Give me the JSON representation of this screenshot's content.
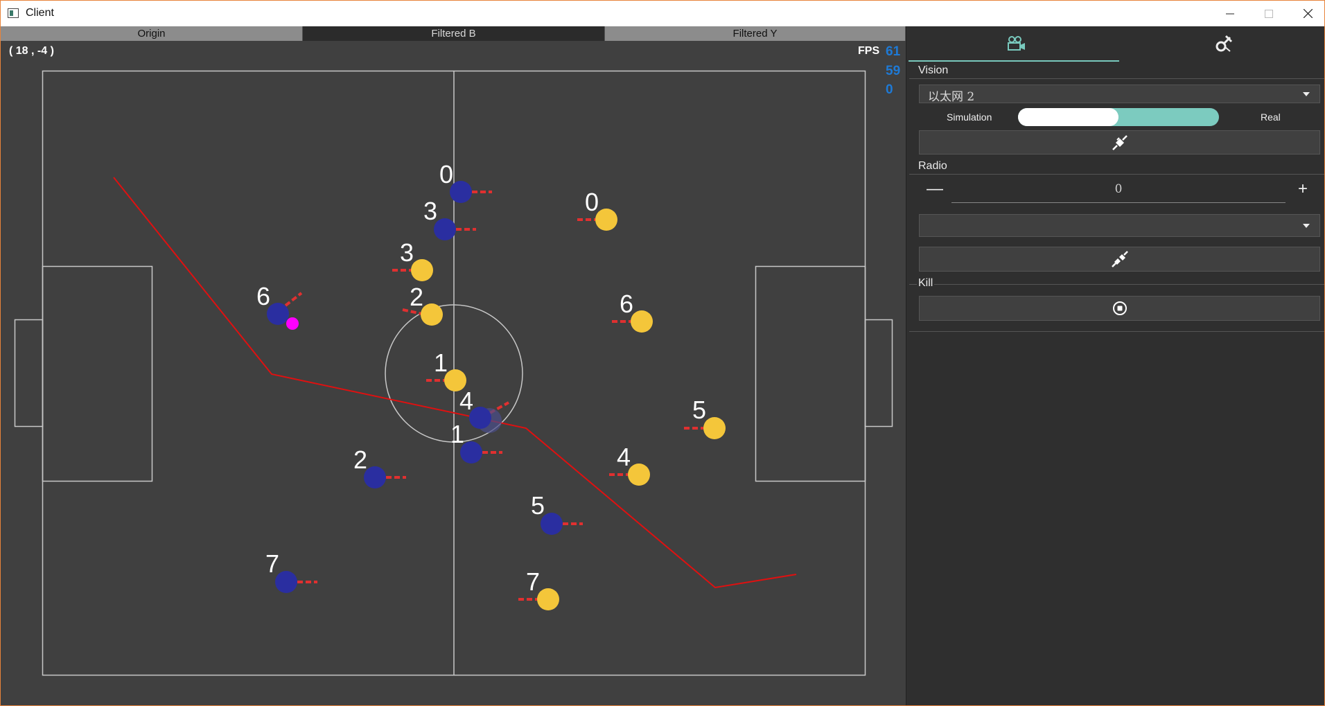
{
  "window": {
    "title": "Client",
    "icon": "app-window-icon"
  },
  "view_tabs": [
    "Origin",
    "Filtered B",
    "Filtered Y"
  ],
  "active_view_tab": 1,
  "status": {
    "cursor_coord": "( 18 , -4 )",
    "fps_label": "FPS",
    "fps_values": [
      "61",
      "59",
      "0"
    ]
  },
  "colors": {
    "field_bg": "#404040",
    "lines": "#c8c8c8",
    "blue_team": "#2a2ea0",
    "yellow_team": "#f4c63a",
    "orientation": "#e03030",
    "path": "#e01010",
    "ball": "#ff00ff",
    "accent": "#79c9bd",
    "fps": "#1e7ad6"
  },
  "field": {
    "blue_robots": [
      "0",
      "3",
      "6",
      "4",
      "1",
      "2",
      "5",
      "7"
    ],
    "yellow_robots": [
      "0",
      "3",
      "2",
      "1",
      "6",
      "5",
      "4",
      "7"
    ]
  },
  "panel": {
    "tabs": [
      {
        "icon": "video-camera-icon",
        "active": true
      },
      {
        "icon": "tools-icon",
        "active": false
      }
    ],
    "vision": {
      "label": "Vision",
      "interface": "以太网 2",
      "toggle_left": "Simulation",
      "toggle_right": "Real",
      "toggle_state": "Simulation",
      "connect_icon": "plug-connected-icon"
    },
    "radio": {
      "label": "Radio",
      "minus": "—",
      "plus": "+",
      "value": "0",
      "port": "",
      "connect_icon": "plug-disconnected-icon"
    },
    "kill": {
      "label": "Kill",
      "icon": "stop-circle-icon"
    }
  }
}
